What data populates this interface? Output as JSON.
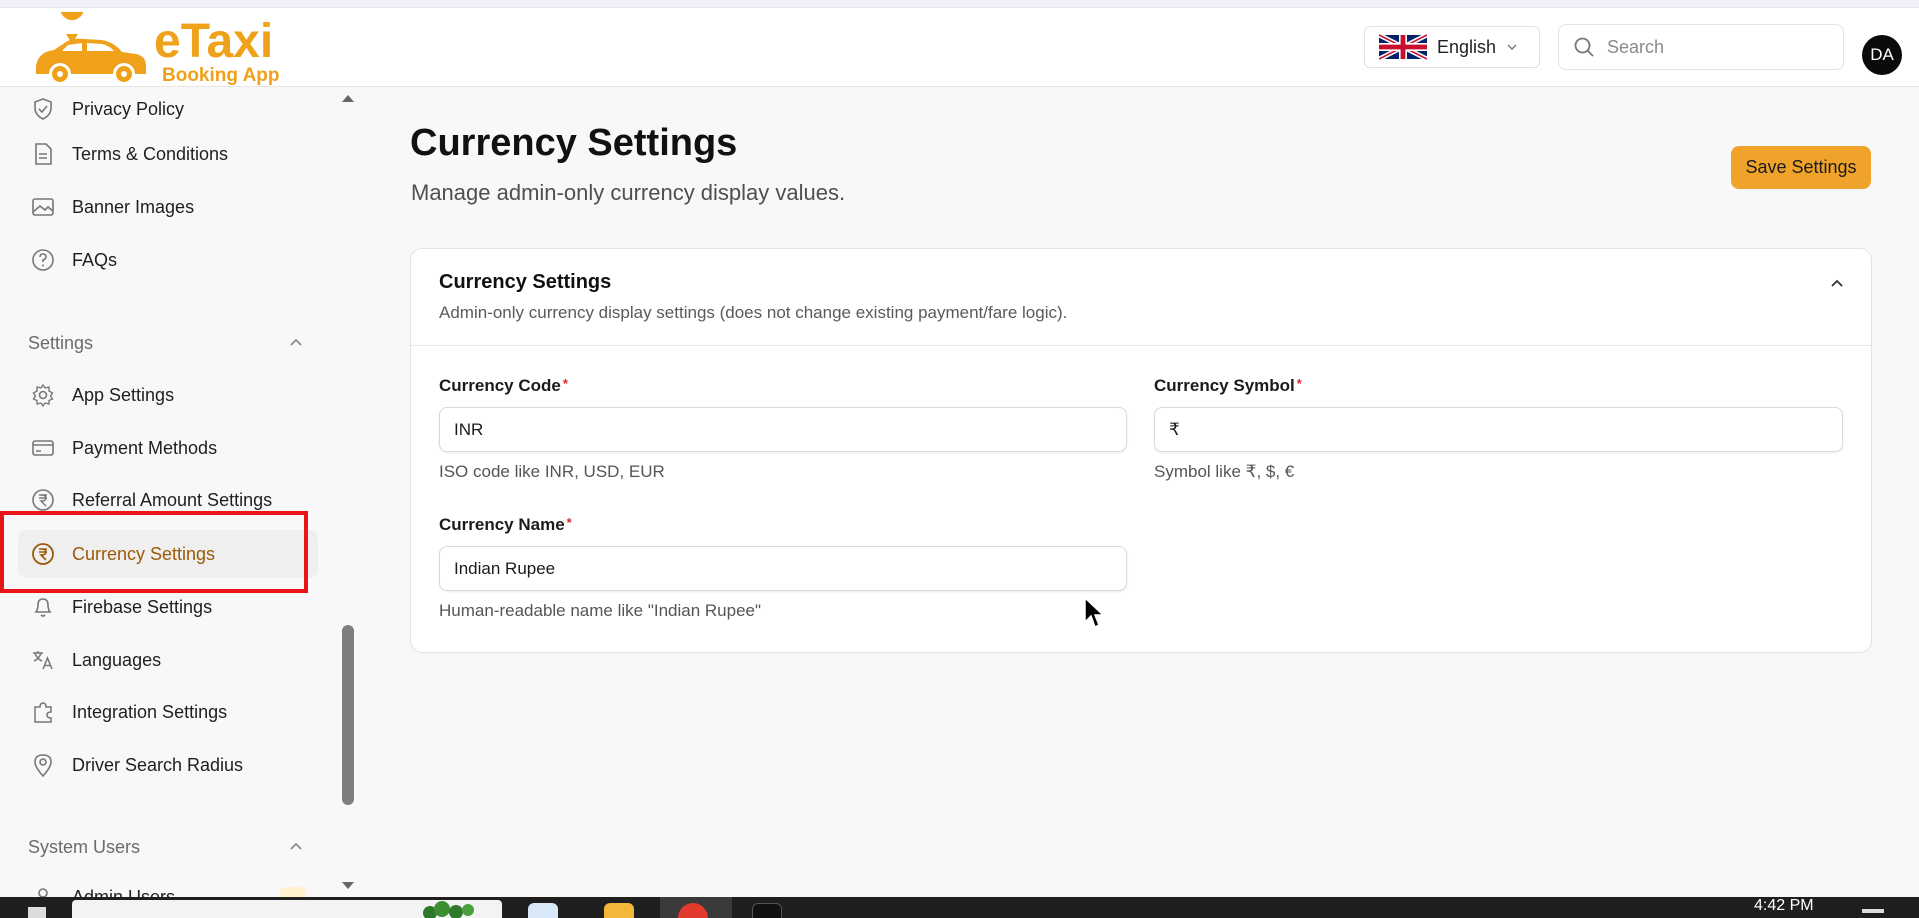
{
  "app": {
    "logo_title": "eTaxi",
    "logo_subtitle": "Booking App"
  },
  "header": {
    "language": "English",
    "search_placeholder": "Search",
    "avatar_initials": "DA"
  },
  "sidebar": {
    "items_top": [
      {
        "label": "Privacy Policy",
        "icon": "shield-check-icon"
      },
      {
        "label": "Terms & Conditions",
        "icon": "document-icon"
      },
      {
        "label": "Banner Images",
        "icon": "image-icon"
      },
      {
        "label": "FAQs",
        "icon": "question-circle-icon"
      }
    ],
    "settings_section": "Settings",
    "settings_items": [
      {
        "label": "App Settings",
        "icon": "gear-icon"
      },
      {
        "label": "Payment Methods",
        "icon": "credit-card-icon"
      },
      {
        "label": "Referral Amount Settings",
        "icon": "rupee-circle-icon"
      },
      {
        "label": "Currency Settings",
        "icon": "rupee-circle-icon",
        "active": true
      },
      {
        "label": "Firebase Settings",
        "icon": "bell-icon"
      },
      {
        "label": "Languages",
        "icon": "translate-icon"
      },
      {
        "label": "Integration Settings",
        "icon": "puzzle-icon"
      },
      {
        "label": "Driver Search Radius",
        "icon": "map-pin-icon"
      }
    ],
    "system_users_section": "System Users",
    "system_users_items": [
      {
        "label": "Admin Users",
        "icon": "user-icon"
      }
    ]
  },
  "main": {
    "title": "Currency Settings",
    "subtitle": "Manage admin-only currency display values.",
    "save_label": "Save Settings",
    "card": {
      "title": "Currency Settings",
      "subtitle": "Admin-only currency display settings (does not change existing payment/fare logic).",
      "fields": {
        "code": {
          "label": "Currency Code",
          "required_mark": "*",
          "value": "INR",
          "help": "ISO code like INR, USD, EUR"
        },
        "symbol": {
          "label": "Currency Symbol",
          "required_mark": "*",
          "value": "₹",
          "help": "Symbol like ₹, $, €"
        },
        "name": {
          "label": "Currency Name",
          "required_mark": "*",
          "value": "Indian Rupee",
          "help": "Human-readable name like \"Indian Rupee\""
        }
      }
    }
  },
  "taskbar": {
    "time": "4:42 PM"
  },
  "colors": {
    "accent": "#f0a32a",
    "brand": "#f0a11a",
    "active_text": "#9a5a08",
    "highlight": "#e8151b"
  }
}
